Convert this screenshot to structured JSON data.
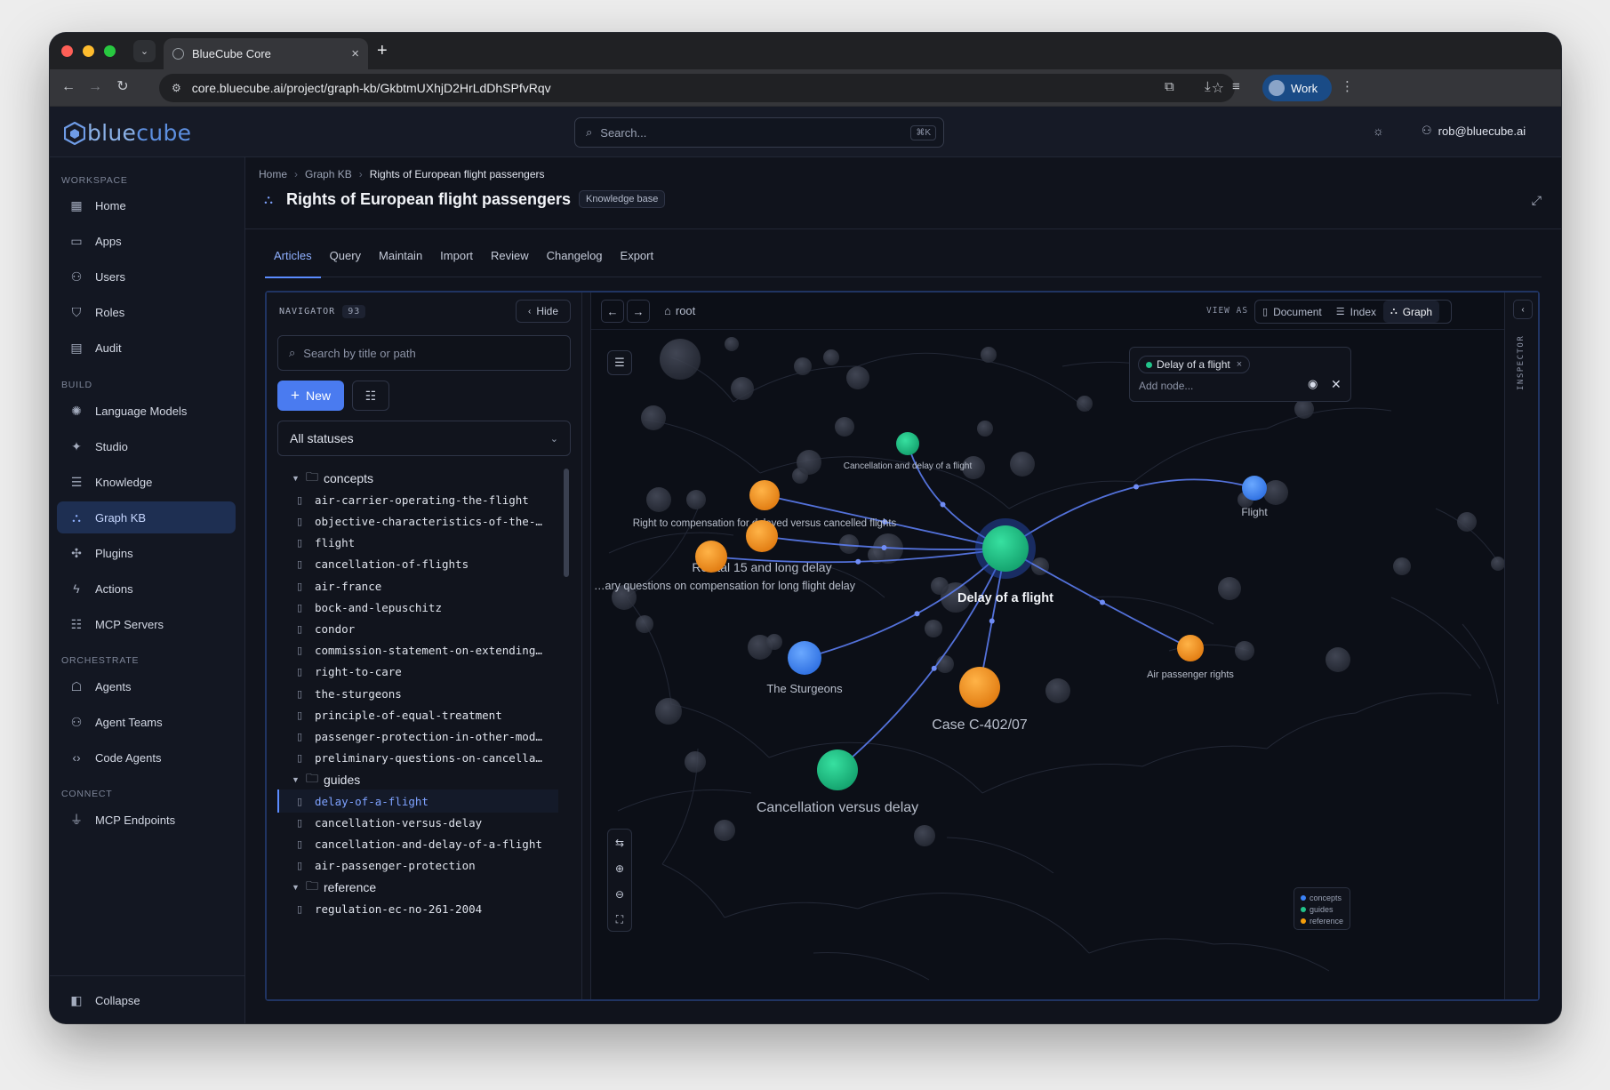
{
  "browser": {
    "tab_title": "BlueCube Core",
    "url": "core.bluecube.ai/project/graph-kb/GkbtmUXhjD2HrLdDhSPfvRqv",
    "profile": "Work"
  },
  "app": {
    "logo_text_a": "blue",
    "logo_text_b": "cube",
    "search_placeholder": "Search...",
    "search_shortcut": "⌘K",
    "user_email": "rob@bluecube.ai"
  },
  "sidebar": {
    "sections": [
      {
        "label": "WORKSPACE",
        "items": [
          {
            "label": "Home",
            "icon": "grid-icon"
          },
          {
            "label": "Apps",
            "icon": "window-icon"
          },
          {
            "label": "Users",
            "icon": "users-icon"
          },
          {
            "label": "Roles",
            "icon": "shield-icon"
          },
          {
            "label": "Audit",
            "icon": "clipboard-icon"
          }
        ]
      },
      {
        "label": "BUILD",
        "items": [
          {
            "label": "Language Models",
            "icon": "brain-icon"
          },
          {
            "label": "Studio",
            "icon": "sparkle-icon"
          },
          {
            "label": "Knowledge",
            "icon": "database-icon"
          },
          {
            "label": "Graph KB",
            "icon": "graph-icon",
            "active": true
          },
          {
            "label": "Plugins",
            "icon": "puzzle-icon"
          },
          {
            "label": "Actions",
            "icon": "bolt-icon"
          },
          {
            "label": "MCP Servers",
            "icon": "server-icon"
          }
        ]
      },
      {
        "label": "ORCHESTRATE",
        "items": [
          {
            "label": "Agents",
            "icon": "bot-icon"
          },
          {
            "label": "Agent Teams",
            "icon": "team-icon"
          },
          {
            "label": "Code Agents",
            "icon": "code-icon"
          }
        ]
      },
      {
        "label": "CONNECT",
        "items": [
          {
            "label": "MCP Endpoints",
            "icon": "plug-icon"
          }
        ]
      }
    ],
    "collapse_label": "Collapse"
  },
  "page": {
    "breadcrumb": [
      "Home",
      "Graph KB",
      "Rights of European flight passengers"
    ],
    "title": "Rights of European flight passengers",
    "badge": "Knowledge base",
    "tabs": [
      "Articles",
      "Query",
      "Maintain",
      "Import",
      "Review",
      "Changelog",
      "Export"
    ],
    "active_tab": "Articles"
  },
  "navigator": {
    "title": "NAVIGATOR",
    "count": "93",
    "hide_label": "Hide",
    "search_placeholder": "Search by title or path",
    "new_label": "New",
    "status_filter": "All statuses",
    "tree": [
      {
        "type": "folder",
        "label": "concepts"
      },
      {
        "type": "file",
        "label": "air-carrier-operating-the-flight"
      },
      {
        "type": "file",
        "label": "objective-characteristics-of-the-…"
      },
      {
        "type": "file",
        "label": "flight"
      },
      {
        "type": "file",
        "label": "cancellation-of-flights"
      },
      {
        "type": "file",
        "label": "air-france"
      },
      {
        "type": "file",
        "label": "bock-and-lepuschitz"
      },
      {
        "type": "file",
        "label": "condor"
      },
      {
        "type": "file",
        "label": "commission-statement-on-extending…"
      },
      {
        "type": "file",
        "label": "right-to-care"
      },
      {
        "type": "file",
        "label": "the-sturgeons"
      },
      {
        "type": "file",
        "label": "principle-of-equal-treatment"
      },
      {
        "type": "file",
        "label": "passenger-protection-in-other-mod…"
      },
      {
        "type": "file",
        "label": "preliminary-questions-on-cancella…"
      },
      {
        "type": "folder",
        "label": "guides"
      },
      {
        "type": "file",
        "label": "delay-of-a-flight",
        "selected": true
      },
      {
        "type": "file",
        "label": "cancellation-versus-delay"
      },
      {
        "type": "file",
        "label": "cancellation-and-delay-of-a-flight"
      },
      {
        "type": "file",
        "label": "air-passenger-protection"
      },
      {
        "type": "folder",
        "label": "reference"
      },
      {
        "type": "file",
        "label": "regulation-ec-no-261-2004"
      }
    ]
  },
  "graph": {
    "root_label": "root",
    "view_as_label": "VIEW AS",
    "views": [
      "Document",
      "Index",
      "Graph"
    ],
    "active_view": "Graph",
    "focus_chip": "Delay of a flight",
    "add_node_placeholder": "Add node...",
    "inspector_label": "INSPECTOR",
    "legend": [
      {
        "label": "concepts",
        "color": "#3b82f6"
      },
      {
        "label": "guides",
        "color": "#22c38a"
      },
      {
        "label": "reference",
        "color": "#f59e0b"
      }
    ],
    "colors": {
      "concepts": "#3b82f6",
      "guides": "#22c38a",
      "reference": "#f59e0b",
      "edge": "#5b7cf0",
      "bg_node": "#343846"
    },
    "center_node": "Delay of a flight",
    "nodes": [
      {
        "id": "center",
        "label": "Delay of a flight",
        "category": "guides"
      },
      {
        "id": "c1",
        "label": "Cancellation and delay of a flight",
        "category": "guides"
      },
      {
        "id": "c2",
        "label": "Right to compensation for delayed versus cancelled flights",
        "category": "reference"
      },
      {
        "id": "c3",
        "label": "Recital 15 and long delay",
        "category": "reference"
      },
      {
        "id": "c4",
        "label": "…ary questions on compensation for long flight delay",
        "category": "reference"
      },
      {
        "id": "c5",
        "label": "Flight",
        "category": "concepts"
      },
      {
        "id": "c6",
        "label": "The Sturgeons",
        "category": "concepts"
      },
      {
        "id": "c7",
        "label": "Case C-402/07",
        "category": "reference"
      },
      {
        "id": "c8",
        "label": "Air passenger rights",
        "category": "reference"
      },
      {
        "id": "c9",
        "label": "Cancellation versus delay",
        "category": "guides"
      }
    ]
  }
}
